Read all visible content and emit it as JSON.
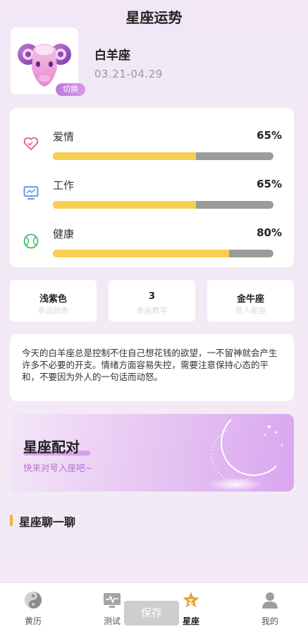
{
  "header": {
    "title": "星座运势"
  },
  "sign": {
    "icon": "aries-ram-icon",
    "switch_label": "切换",
    "name": "白羊座",
    "dates": "03.21-04.29"
  },
  "fortune": {
    "items": [
      {
        "label": "爱情",
        "percent_text": "65%",
        "percent": 65,
        "icon": "heart-icon",
        "icon_color": "#e25f6b"
      },
      {
        "label": "工作",
        "percent_text": "65%",
        "percent": 65,
        "icon": "monitor-icon",
        "icon_color": "#5b8fe0"
      },
      {
        "label": "健康",
        "percent_text": "80%",
        "percent": 80,
        "icon": "ball-icon",
        "icon_color": "#3cbf6a"
      }
    ],
    "bar_fill_color": "#f8d050",
    "bar_track_color": "#9b9b9b"
  },
  "lucky": [
    {
      "value": "浅紫色",
      "label": "幸运颜色"
    },
    {
      "value": "3",
      "label": "幸运数字"
    },
    {
      "value": "金牛座",
      "label": "贵人星座"
    }
  ],
  "description": "今天的白羊座总是控制不住自己想花钱的欲望，一不留神就会产生许多不必要的开支。情绪方面容易失控，需要注意保持心态的平和，不要因为外人的一句话而动怒。",
  "pairing": {
    "title": "星座配对",
    "subtitle": "快来对号入座吧~",
    "icon": "crescent-moon-icon"
  },
  "chat_section": {
    "title": "星座聊一聊"
  },
  "save_button": "保存",
  "tabbar": {
    "items": [
      {
        "label": "黄历",
        "icon": "yin-yang-icon"
      },
      {
        "label": "测试",
        "icon": "pulse-monitor-icon"
      },
      {
        "label": "星座",
        "icon": "star-icon",
        "active": true
      },
      {
        "label": "我的",
        "icon": "user-icon"
      }
    ]
  },
  "colors": {
    "accent": "#c67ce8",
    "star": "#e6a23c"
  }
}
